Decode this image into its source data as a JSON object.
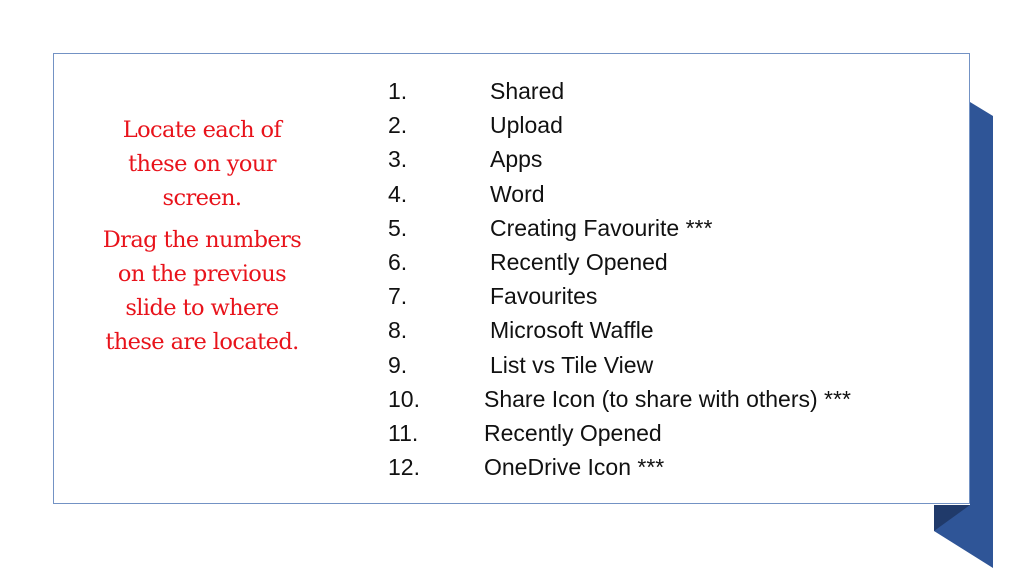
{
  "instructions": {
    "paragraph_1": [
      "Locate each of",
      "these on your",
      "screen."
    ],
    "paragraph_2": [
      "Drag the numbers",
      "on the previous",
      "slide to where",
      "these are located."
    ]
  },
  "items": [
    {
      "number": "1.",
      "label": "Shared"
    },
    {
      "number": "2.",
      "label": "Upload"
    },
    {
      "number": "3.",
      "label": "Apps"
    },
    {
      "number": "4.",
      "label": "Word"
    },
    {
      "number": "5.",
      "label": "Creating Favourite ***"
    },
    {
      "number": "6.",
      "label": "Recently Opened"
    },
    {
      "number": "7.",
      "label": "Favourites"
    },
    {
      "number": "8.",
      "label": "Microsoft Waffle"
    },
    {
      "number": "9.",
      "label": "List vs Tile View"
    },
    {
      "number": "10.",
      "label": "Share Icon (to share with others) ***"
    },
    {
      "number": "11.",
      "label": "Recently Opened"
    },
    {
      "number": "12.",
      "label": "OneDrive Icon ***"
    }
  ],
  "colors": {
    "instruction_text": "#e8131b",
    "border": "#7392c4",
    "ribbon": "#2f5597",
    "ribbon_fold": "#203a6a"
  }
}
